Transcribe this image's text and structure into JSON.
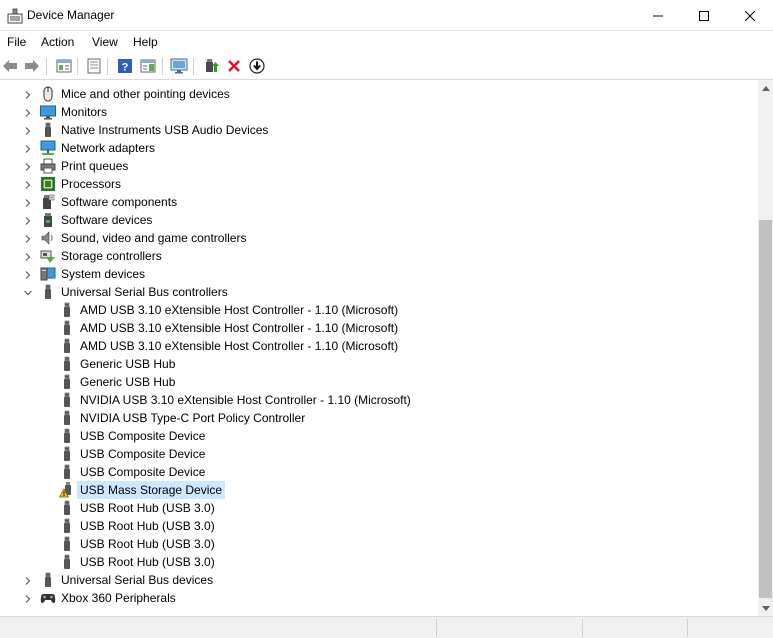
{
  "window": {
    "title": "Device Manager"
  },
  "menu": {
    "file": "File",
    "action": "Action",
    "view": "View",
    "help": "Help"
  },
  "colors": {
    "selection": "#cce8ff",
    "error_red": "#e81123",
    "usb_gray": "#555555",
    "warning": "#f5c518"
  },
  "tree": [
    {
      "label": "Mice and other pointing devices",
      "icon": "mouse-icon",
      "level": 0,
      "expander": "collapsed"
    },
    {
      "label": "Monitors",
      "icon": "monitor-icon",
      "level": 0,
      "expander": "collapsed"
    },
    {
      "label": "Native Instruments USB Audio Devices",
      "icon": "usb-plug-icon",
      "level": 0,
      "expander": "collapsed"
    },
    {
      "label": "Network adapters",
      "icon": "network-adapter-icon",
      "level": 0,
      "expander": "collapsed"
    },
    {
      "label": "Print queues",
      "icon": "printer-icon",
      "level": 0,
      "expander": "collapsed"
    },
    {
      "label": "Processors",
      "icon": "processor-icon",
      "level": 0,
      "expander": "collapsed"
    },
    {
      "label": "Software components",
      "icon": "software-component-icon",
      "level": 0,
      "expander": "collapsed"
    },
    {
      "label": "Software devices",
      "icon": "software-device-icon",
      "level": 0,
      "expander": "collapsed"
    },
    {
      "label": "Sound, video and game controllers",
      "icon": "speaker-icon",
      "level": 0,
      "expander": "collapsed"
    },
    {
      "label": "Storage controllers",
      "icon": "storage-controller-icon",
      "level": 0,
      "expander": "collapsed"
    },
    {
      "label": "System devices",
      "icon": "system-device-icon",
      "level": 0,
      "expander": "collapsed"
    },
    {
      "label": "Universal Serial Bus controllers",
      "icon": "usb-plug-icon",
      "level": 0,
      "expander": "expanded"
    },
    {
      "label": "AMD USB 3.10 eXtensible Host Controller - 1.10 (Microsoft)",
      "icon": "usb-plug-icon",
      "level": 1,
      "expander": "none"
    },
    {
      "label": "AMD USB 3.10 eXtensible Host Controller - 1.10 (Microsoft)",
      "icon": "usb-plug-icon",
      "level": 1,
      "expander": "none"
    },
    {
      "label": "AMD USB 3.10 eXtensible Host Controller - 1.10 (Microsoft)",
      "icon": "usb-plug-icon",
      "level": 1,
      "expander": "none"
    },
    {
      "label": "Generic USB Hub",
      "icon": "usb-plug-icon",
      "level": 1,
      "expander": "none"
    },
    {
      "label": "Generic USB Hub",
      "icon": "usb-plug-icon",
      "level": 1,
      "expander": "none"
    },
    {
      "label": "NVIDIA USB 3.10 eXtensible Host Controller - 1.10 (Microsoft)",
      "icon": "usb-plug-icon",
      "level": 1,
      "expander": "none"
    },
    {
      "label": "NVIDIA USB Type-C Port Policy Controller",
      "icon": "usb-plug-icon",
      "level": 1,
      "expander": "none"
    },
    {
      "label": "USB Composite Device",
      "icon": "usb-plug-icon",
      "level": 1,
      "expander": "none"
    },
    {
      "label": "USB Composite Device",
      "icon": "usb-plug-icon",
      "level": 1,
      "expander": "none"
    },
    {
      "label": "USB Composite Device",
      "icon": "usb-plug-icon",
      "level": 1,
      "expander": "none"
    },
    {
      "label": "USB Mass Storage Device",
      "icon": "usb-warning-icon",
      "level": 1,
      "expander": "none",
      "selected": true
    },
    {
      "label": "USB Root Hub (USB 3.0)",
      "icon": "usb-plug-icon",
      "level": 1,
      "expander": "none"
    },
    {
      "label": "USB Root Hub (USB 3.0)",
      "icon": "usb-plug-icon",
      "level": 1,
      "expander": "none"
    },
    {
      "label": "USB Root Hub (USB 3.0)",
      "icon": "usb-plug-icon",
      "level": 1,
      "expander": "none"
    },
    {
      "label": "USB Root Hub (USB 3.0)",
      "icon": "usb-plug-icon",
      "level": 1,
      "expander": "none"
    },
    {
      "label": "Universal Serial Bus devices",
      "icon": "usb-plug-icon",
      "level": 0,
      "expander": "collapsed"
    },
    {
      "label": "Xbox 360 Peripherals",
      "icon": "gamepad-icon",
      "level": 0,
      "expander": "collapsed"
    }
  ]
}
